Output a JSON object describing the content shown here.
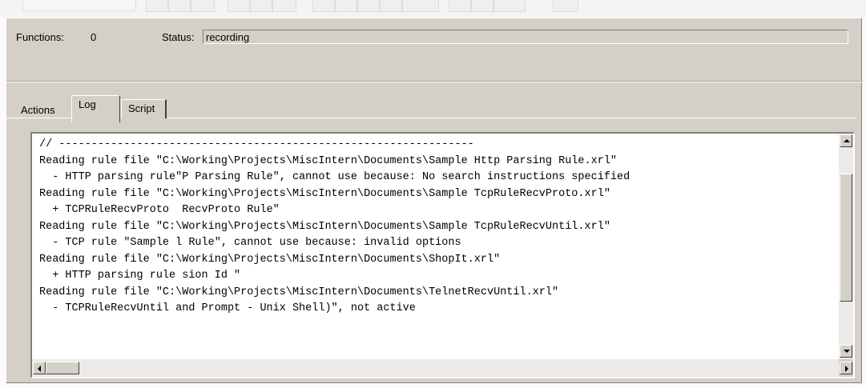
{
  "status_bar": {
    "functions_label": "Functions:",
    "functions_value": "0",
    "status_label": "Status:",
    "status_value": "recording"
  },
  "tabs": [
    {
      "label": "Actions",
      "selected": false
    },
    {
      "label": "Log",
      "selected": true
    },
    {
      "label": "Script",
      "selected": false
    }
  ],
  "log": {
    "lines": [
      "// ----------------------------------------------------------------",
      "",
      "Reading rule file \"C:\\Working\\Projects\\MiscIntern\\Documents\\Sample Http Parsing Rule.xrl\"",
      "  - HTTP parsing rule\"P Parsing Rule\", cannot use because: No search instructions specified",
      "Reading rule file \"C:\\Working\\Projects\\MiscIntern\\Documents\\Sample TcpRuleRecvProto.xrl\"",
      "  + TCPRuleRecvProto  RecvProto Rule\"",
      "Reading rule file \"C:\\Working\\Projects\\MiscIntern\\Documents\\Sample TcpRuleRecvUntil.xrl\"",
      "  - TCP rule \"Sample l Rule\", cannot use because: invalid options",
      "Reading rule file \"C:\\Working\\Projects\\MiscIntern\\Documents\\ShopIt.xrl\"",
      "  + HTTP parsing rule sion Id \"",
      "Reading rule file \"C:\\Working\\Projects\\MiscIntern\\Documents\\TelnetRecvUntil.xrl\"",
      "  - TCPRuleRecvUntil and Prompt - Unix Shell)\", not active"
    ]
  },
  "icons": {
    "scroll_up": "triangle-up-icon",
    "scroll_down": "triangle-down-icon",
    "scroll_left": "triangle-left-icon",
    "scroll_right": "triangle-right-icon"
  },
  "colors": {
    "panel": "#d4d0c8",
    "log_background": "#ffffff",
    "scroll_track": "#ebeae6"
  }
}
